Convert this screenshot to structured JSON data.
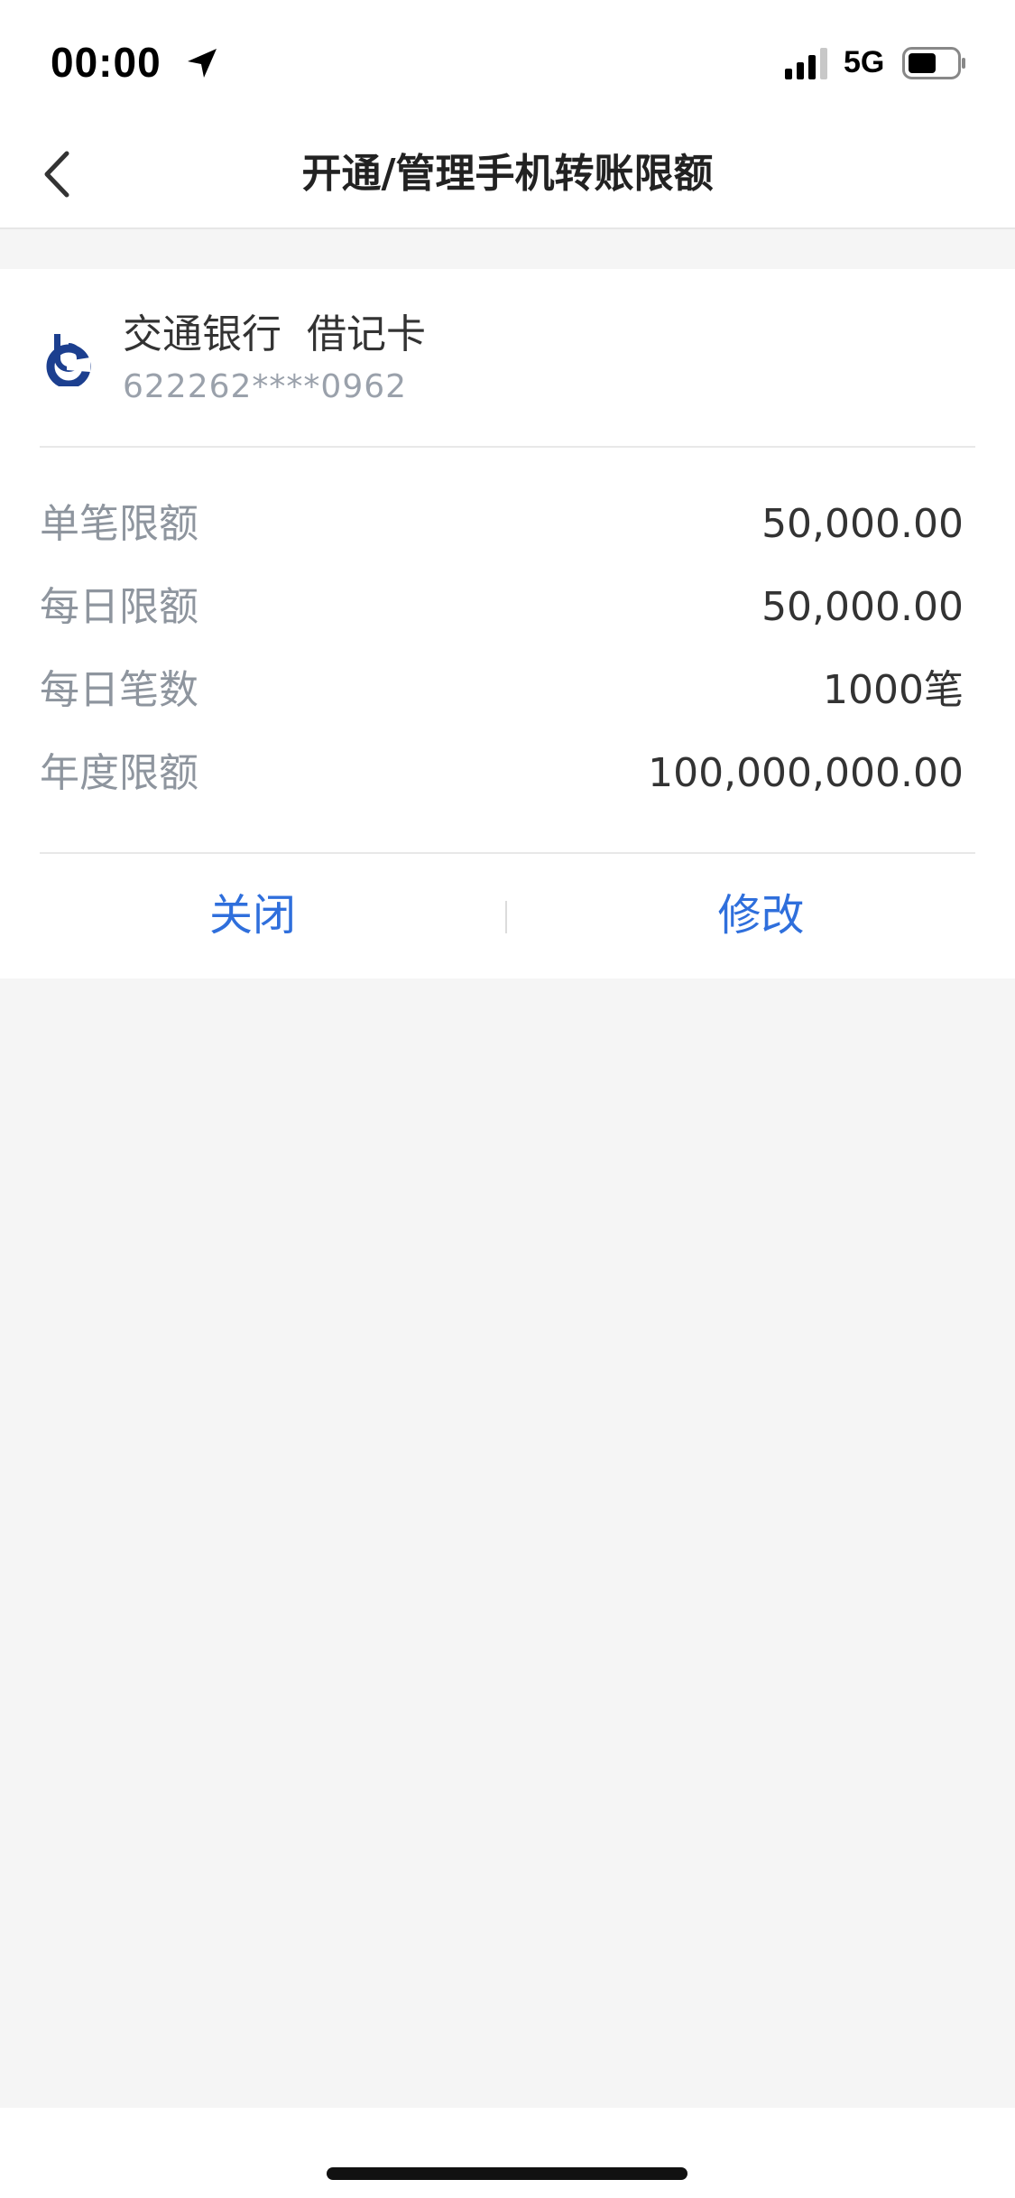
{
  "status_bar": {
    "time": "00:00",
    "network": "5G",
    "icons": [
      "location-arrow-icon",
      "signal-icon",
      "battery-icon"
    ]
  },
  "nav": {
    "title": "开通/管理手机转账限额",
    "back_icon": "chevron-left-icon"
  },
  "card": {
    "bank_name": "交通银行  借记卡",
    "card_number": "622262****0962",
    "logo_icon": "bank-logo-icon",
    "limits": [
      {
        "label": "单笔限额",
        "value": "50,000.00"
      },
      {
        "label": "每日限额",
        "value": "50,000.00"
      },
      {
        "label": "每日笔数",
        "value": "1000笔"
      },
      {
        "label": "年度限额",
        "value": "100,000,000.00"
      }
    ],
    "actions": {
      "close_label": "关闭",
      "modify_label": "修改"
    }
  },
  "colors": {
    "accent": "#2f6fdc",
    "background": "#f5f5f5",
    "logo": "#1c3f8f"
  }
}
